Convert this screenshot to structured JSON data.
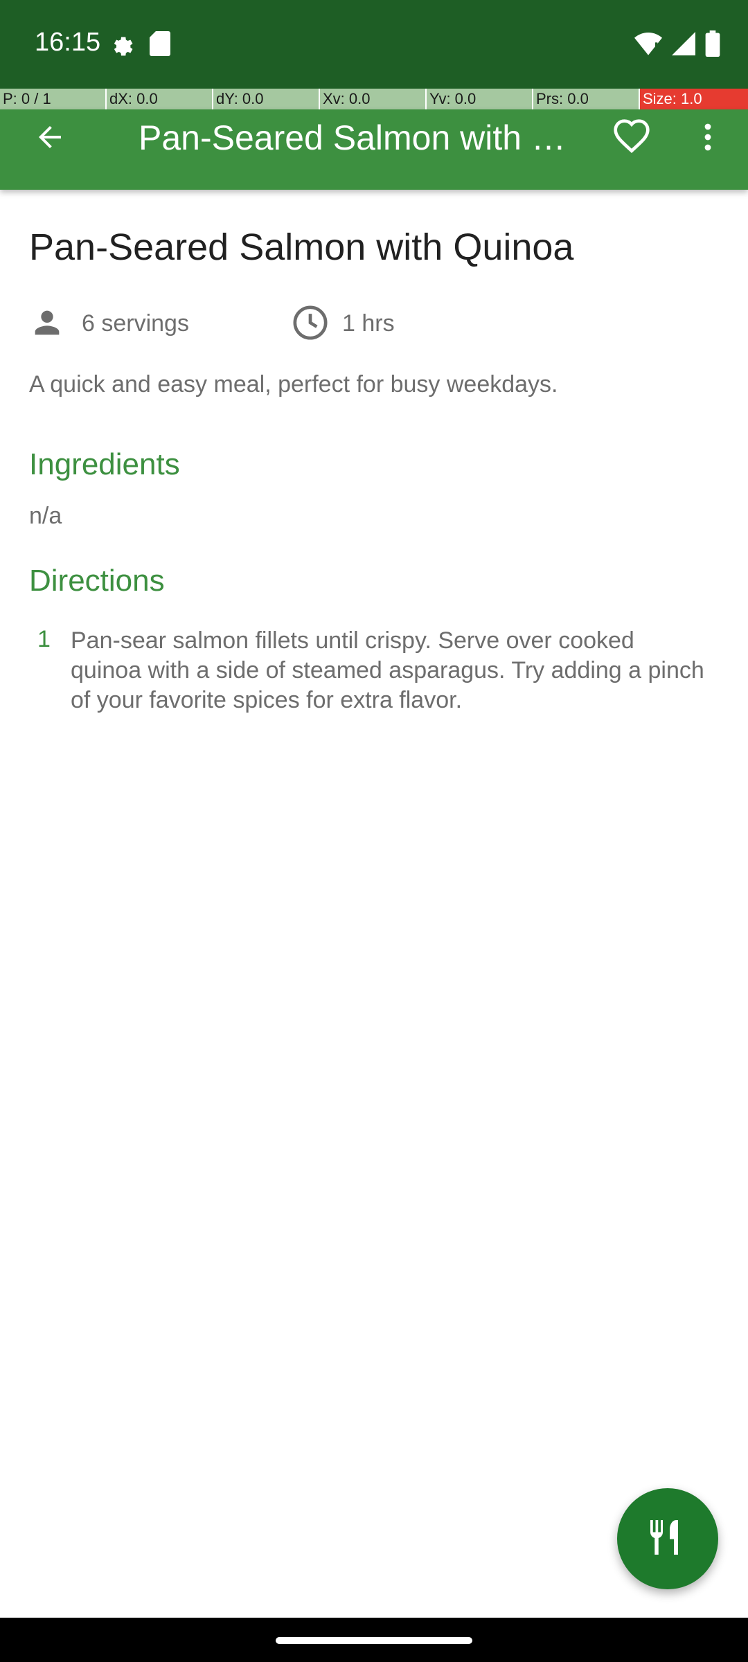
{
  "status_bar": {
    "time": "16:15",
    "left_icons": [
      "settings-gear-icon",
      "sd-card-icon"
    ],
    "right_icons": [
      "wifi-icon",
      "cell-signal-icon",
      "battery-icon"
    ]
  },
  "debug_bar": {
    "cells": [
      "P: 0 / 1",
      "dX: 0.0",
      "dY: 0.0",
      "Xv: 0.0",
      "Yv: 0.0",
      "Prs: 0.0",
      "Size: 1.0"
    ]
  },
  "app_bar": {
    "title": "Pan-Seared Salmon with Quinoa",
    "back_icon": "arrow-back-icon",
    "favorite_icon": "heart-outline-icon",
    "more_icon": "more-vert-icon"
  },
  "recipe": {
    "title": "Pan-Seared Salmon with Quinoa",
    "servings": "6 servings",
    "time": "1 hrs",
    "description": "A quick and easy meal, perfect for busy weekdays.",
    "ingredients_heading": "Ingredients",
    "ingredients_text": "n/a",
    "directions_heading": "Directions",
    "directions": [
      {
        "number": "1",
        "text": "Pan-sear salmon fillets until crispy. Serve over cooked quinoa with a side of steamed asparagus. Try adding a pinch of your favorite spices for extra flavor."
      }
    ]
  },
  "fab": {
    "icon": "fork-knife-icon"
  },
  "colors": {
    "status_bar": "#1e5e25",
    "app_bar": "#3d9040",
    "accent": "#3d9040",
    "fab": "#1e7a2c"
  }
}
